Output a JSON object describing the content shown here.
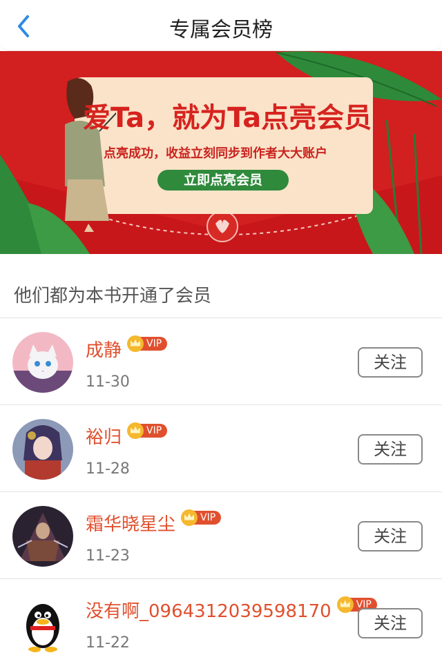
{
  "header": {
    "title": "专属会员榜",
    "back_icon": "chevron-left-icon"
  },
  "banner": {
    "headline": "爱Ta，就为Ta点亮会员",
    "subtitle": "点亮成功，收益立刻同步到作者大大账户",
    "cta_label": "立即点亮会员"
  },
  "section": {
    "title": "他们都为本书开通了会员"
  },
  "members": [
    {
      "name": "成静",
      "badge": "VIP",
      "date": "11-30",
      "follow_label": "关注"
    },
    {
      "name": "裕归",
      "badge": "VIP",
      "date": "11-28",
      "follow_label": "关注"
    },
    {
      "name": "霜华晓星尘",
      "badge": "VIP",
      "date": "11-23",
      "follow_label": "关注"
    },
    {
      "name": "没有啊_0964312039598170",
      "badge": "VIP",
      "date": "11-22",
      "follow_label": "关注"
    }
  ],
  "colors": {
    "accent": "#e0502e",
    "banner_red": "#d21f1f",
    "cta_green": "#2f8a3b",
    "back_blue": "#2e8ae6"
  }
}
